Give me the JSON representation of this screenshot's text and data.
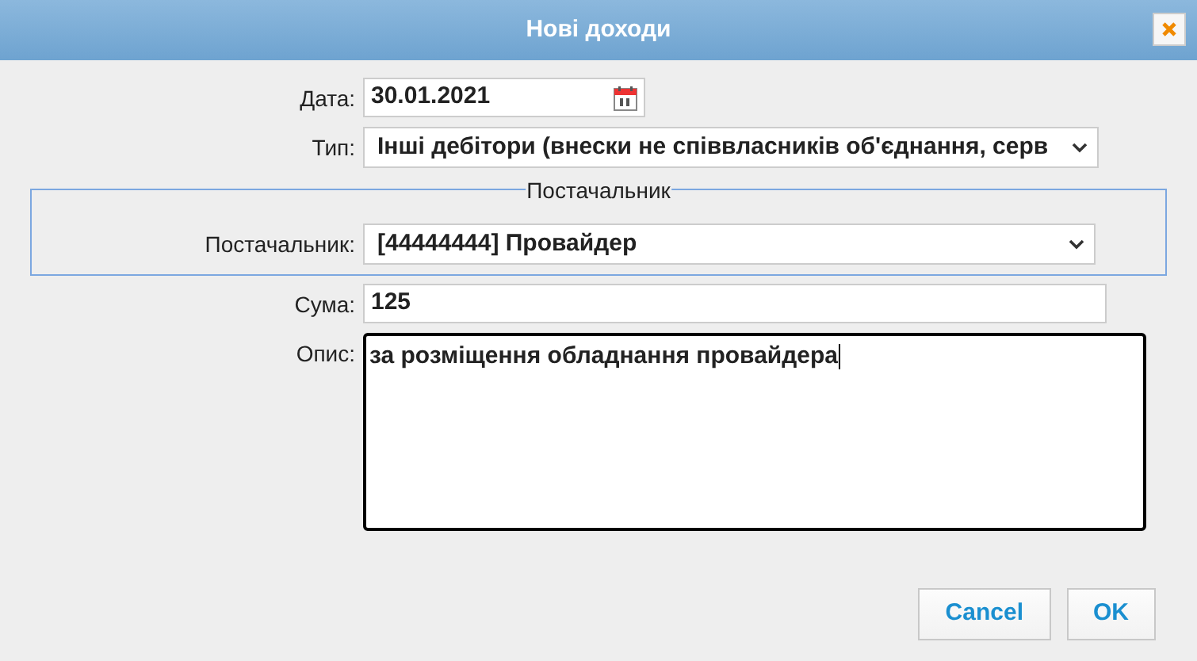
{
  "window": {
    "title": "Нові доходи"
  },
  "fields": [
    {
      "label": "Дата:",
      "kind": "date",
      "value": "30.01.2021"
    },
    {
      "label": "Тип:",
      "kind": "select",
      "value": "Інші дебітори (внески не співвласників об'єднання, серв"
    }
  ],
  "fieldset": {
    "legend": "Постачальник",
    "fields": [
      {
        "label": "Постачальник:",
        "kind": "select",
        "value": "[44444444] Провайдер"
      }
    ]
  },
  "fields_after": [
    {
      "label": "Сума:",
      "kind": "text",
      "value": "125"
    },
    {
      "label": "Опис:",
      "kind": "textarea",
      "value": "за розміщення обладнання провайдера",
      "focused": true
    }
  ],
  "buttons": [
    "Cancel",
    "OK"
  ]
}
